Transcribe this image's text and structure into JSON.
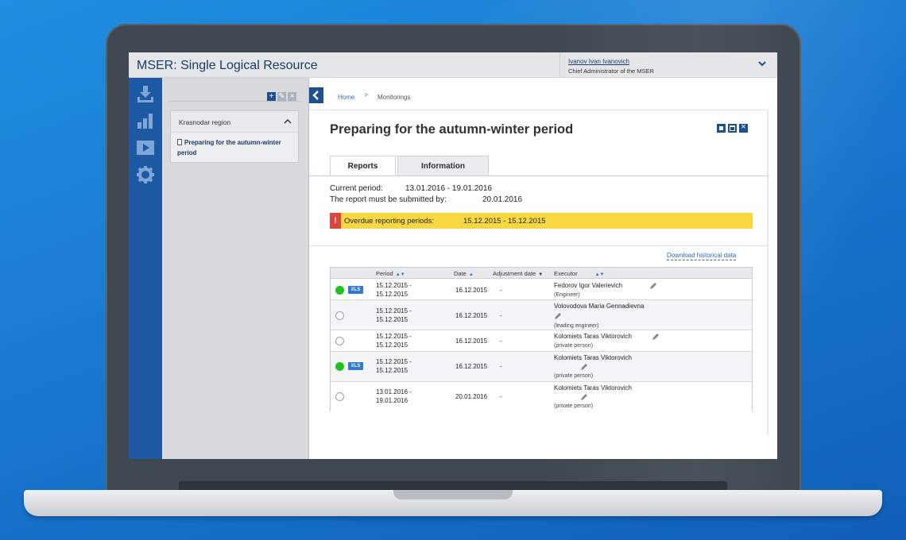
{
  "app": {
    "title": "MSER: Single Logical Resource",
    "user_name": "Ivanov Ivan Ivanovich",
    "user_role": "Chief Administrator of the MSER"
  },
  "tree": {
    "region": "Krasnodar region",
    "item": "Preparing for the autumn-winter period"
  },
  "breadcrumb": {
    "home": "Home",
    "separator": ">",
    "current": "Monitorings"
  },
  "page": {
    "title": "Preparing for the autumn-winter period",
    "tabs": [
      "Reports",
      "Information"
    ],
    "current_period_label": "Current period:",
    "current_period_value": "13.01.2016 - 19.01.2016",
    "submit_label": "The report must be submitted by:",
    "submit_value": "20.01.2016",
    "overdue_label": "Overdue reporting periods:",
    "overdue_value": "15.12.2015 - 15.12.2015",
    "overdue_icon": "!",
    "download_link": "Download historical data"
  },
  "table": {
    "headers": {
      "period": "Period",
      "date": "Date",
      "adjustment": "Adjustment date",
      "executor": "Executor"
    },
    "xls_label": "XLS",
    "rows": [
      {
        "status": "green",
        "xls": true,
        "period_start": "15.12.2015 -",
        "period_end": "15.12.2015",
        "date": "16.12.2015",
        "adjustment": "-",
        "executor": "Fedorov Igor Valerievich",
        "role": "(Engineer)"
      },
      {
        "status": "empty",
        "xls": false,
        "period_start": "15.12.2015 -",
        "period_end": "15.12.2015",
        "date": "16.12.2015",
        "adjustment": "-",
        "executor": "Volovodova Maria Gennadievna",
        "role": "(leading engineer)"
      },
      {
        "status": "empty",
        "xls": false,
        "period_start": "15.12.2015 -",
        "period_end": "15.12.2015",
        "date": "16.12.2015",
        "adjustment": "-",
        "executor": "Kolomiets Taras Viktorovich",
        "role": "(private person)"
      },
      {
        "status": "green",
        "xls": true,
        "period_start": "15.12.2015 -",
        "period_end": "15.12.2015",
        "date": "16.12.2015",
        "adjustment": "-",
        "executor": "Kolomiets Taras Viktorovich",
        "role": "(private person)"
      },
      {
        "status": "empty",
        "xls": false,
        "period_start": "13.01.2016 -",
        "period_end": "19.01.2016",
        "date": "20.01.2016",
        "adjustment": "-",
        "executor": "Kolomiets Taras Viktorovich",
        "role": "(private person)"
      }
    ]
  },
  "colors": {
    "brand_blue": "#1d5aa3",
    "title_navy": "#1b3b6a",
    "overdue_yellow": "#f8d841",
    "alert_red": "#e2443b",
    "status_green": "#1ec41e",
    "xls_blue": "#2f7ad6"
  },
  "icons": {
    "iconbar": [
      "download-icon",
      "bar-chart-icon",
      "play-icon",
      "gear-icon"
    ],
    "tree_tools": [
      "add-icon",
      "edit-icon",
      "close-icon"
    ],
    "window_controls": [
      "minimize-icon",
      "maximize-icon",
      "close-icon"
    ]
  }
}
